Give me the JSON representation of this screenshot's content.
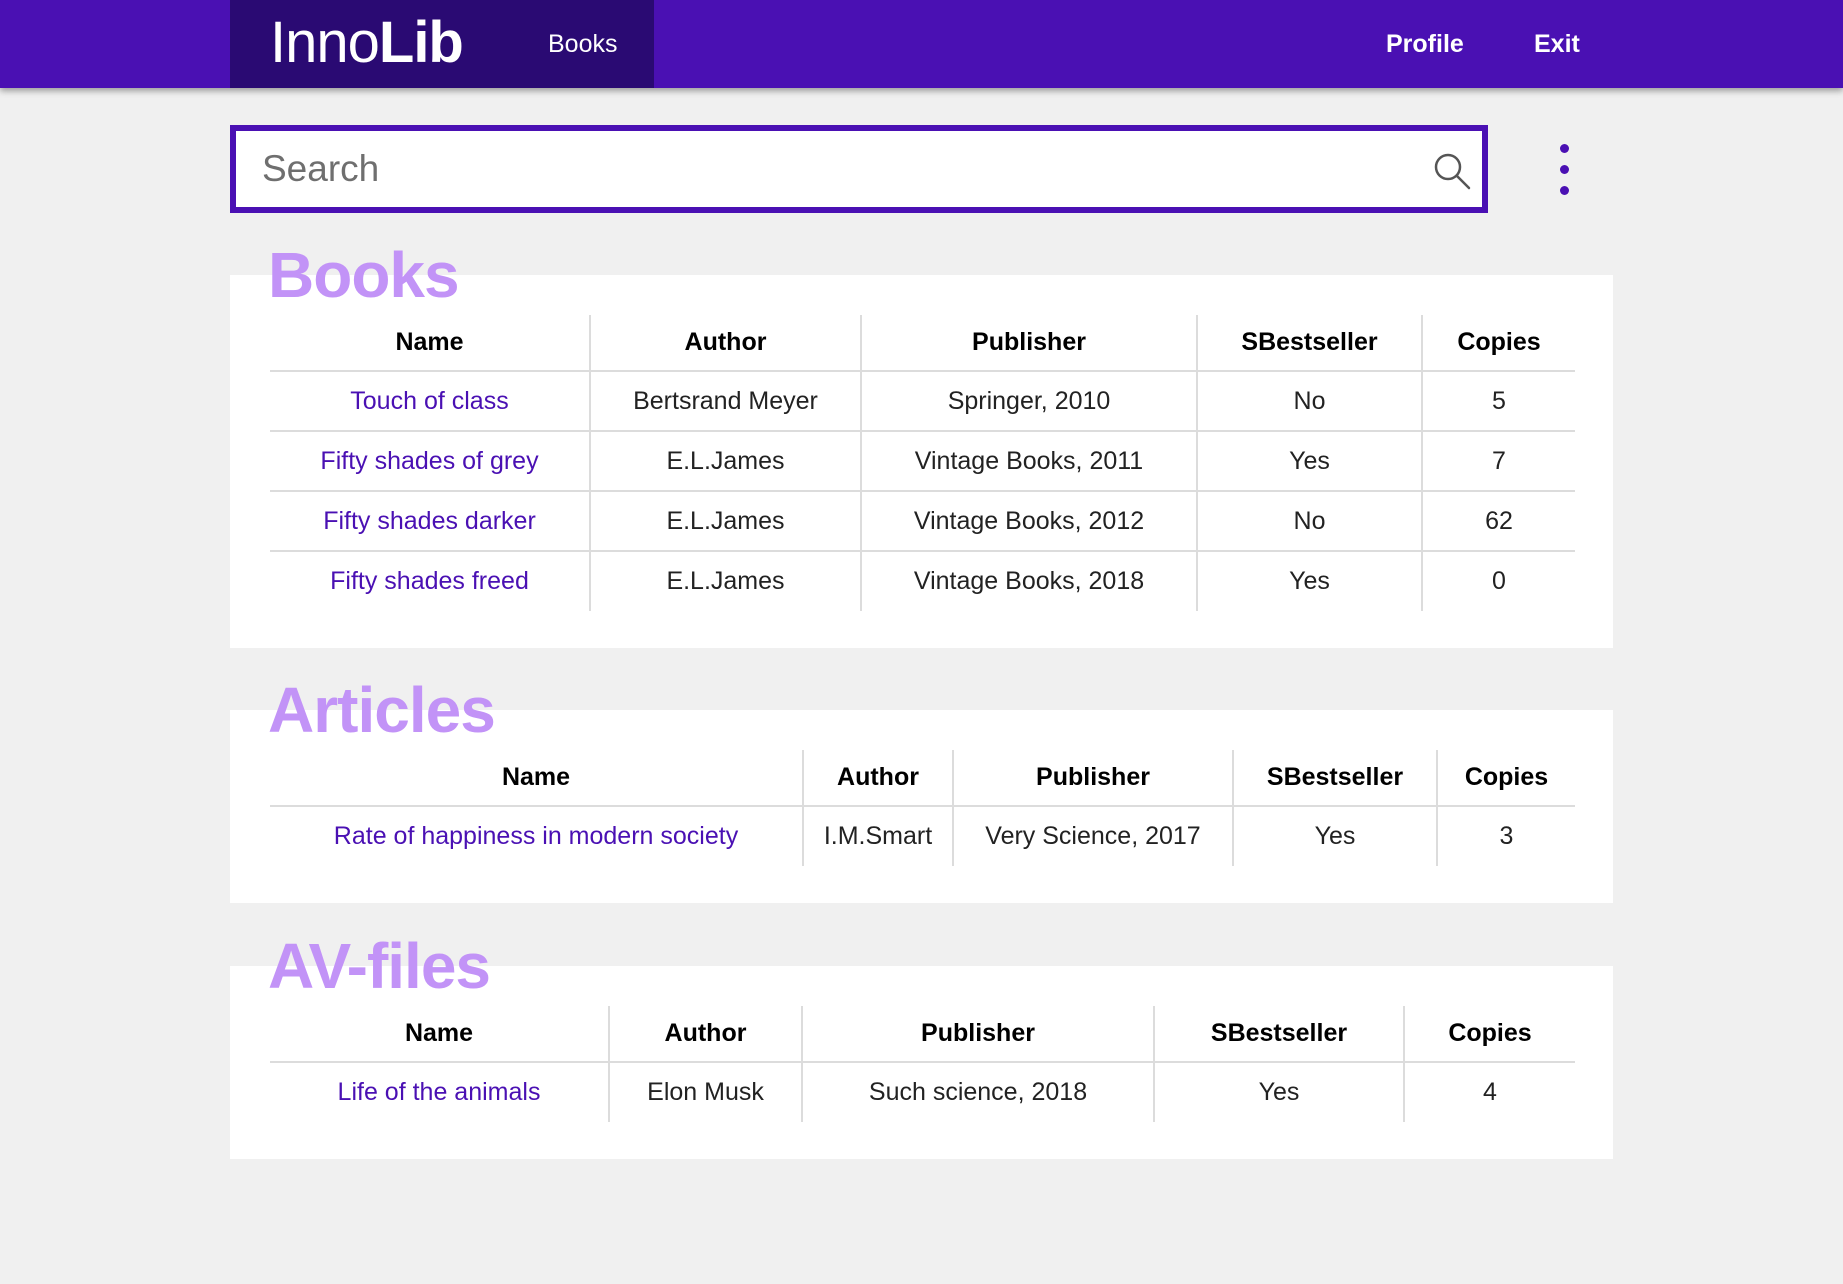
{
  "header": {
    "logo_light": "Inno",
    "logo_bold": "Lib",
    "nav_books": "Books",
    "profile": "Profile",
    "exit": "Exit"
  },
  "search": {
    "placeholder": "Search",
    "value": ""
  },
  "colors": {
    "accent": "#4a10b3",
    "accent_dark": "#2a0a73",
    "section_title": "#c293f7",
    "link": "#4a10b3",
    "background": "#f0f0f0"
  },
  "icons": {
    "search": "search-icon",
    "more": "more-vertical-icon"
  },
  "books": {
    "title": "Books",
    "columns": [
      "Name",
      "Author",
      "Publisher",
      "SBestseller",
      "Copies"
    ],
    "rows": [
      [
        "Touch of class",
        "Bertsrand Meyer",
        "Springer, 2010",
        "No",
        "5"
      ],
      [
        "Fifty shades of grey",
        "E.L.James",
        "Vintage Books, 2011",
        "Yes",
        "7"
      ],
      [
        "Fifty shades darker",
        "E.L.James",
        "Vintage Books, 2012",
        "No",
        "62"
      ],
      [
        "Fifty shades freed",
        "E.L.James",
        "Vintage Books, 2018",
        "Yes",
        "0"
      ]
    ]
  },
  "articles": {
    "title": "Articles",
    "columns": [
      "Name",
      "Author",
      "Publisher",
      "SBestseller",
      "Copies"
    ],
    "rows": [
      [
        "Rate of happiness in modern society",
        "I.M.Smart",
        "Very Science, 2017",
        "Yes",
        "3"
      ]
    ]
  },
  "av_files": {
    "title": "AV-files",
    "columns": [
      "Name",
      "Author",
      "Publisher",
      "SBestseller",
      "Copies"
    ],
    "rows": [
      [
        "Life of the animals",
        "Elon Musk",
        "Such science, 2018",
        "Yes",
        "4"
      ]
    ]
  }
}
